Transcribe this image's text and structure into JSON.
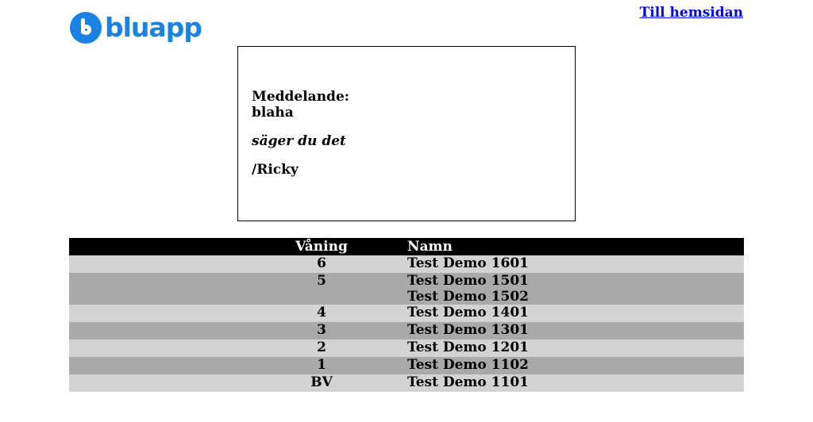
{
  "header": {
    "logo_text": "bluapp",
    "home_link": "Till hemsidan"
  },
  "message": {
    "label": "Meddelande:",
    "body": "blaha",
    "italic_line": "säger du det",
    "author": "/Ricky"
  },
  "table": {
    "headers": {
      "floor": "Våning",
      "name": "Namn"
    },
    "rows": [
      {
        "floor": "6",
        "names": [
          "Test Demo 1601"
        ]
      },
      {
        "floor": "5",
        "names": [
          "Test Demo 1501",
          "Test Demo 1502"
        ]
      },
      {
        "floor": "4",
        "names": [
          "Test Demo 1401"
        ]
      },
      {
        "floor": "3",
        "names": [
          "Test Demo 1301"
        ]
      },
      {
        "floor": "2",
        "names": [
          "Test Demo 1201"
        ]
      },
      {
        "floor": "1",
        "names": [
          "Test Demo 1102"
        ]
      },
      {
        "floor": "BV",
        "names": [
          "Test Demo 1101"
        ]
      }
    ]
  },
  "colors": {
    "brand": "#1a82e2",
    "row_light": "#d3d3d3",
    "row_dark": "#a9a9a9",
    "header_bg": "#000000"
  }
}
